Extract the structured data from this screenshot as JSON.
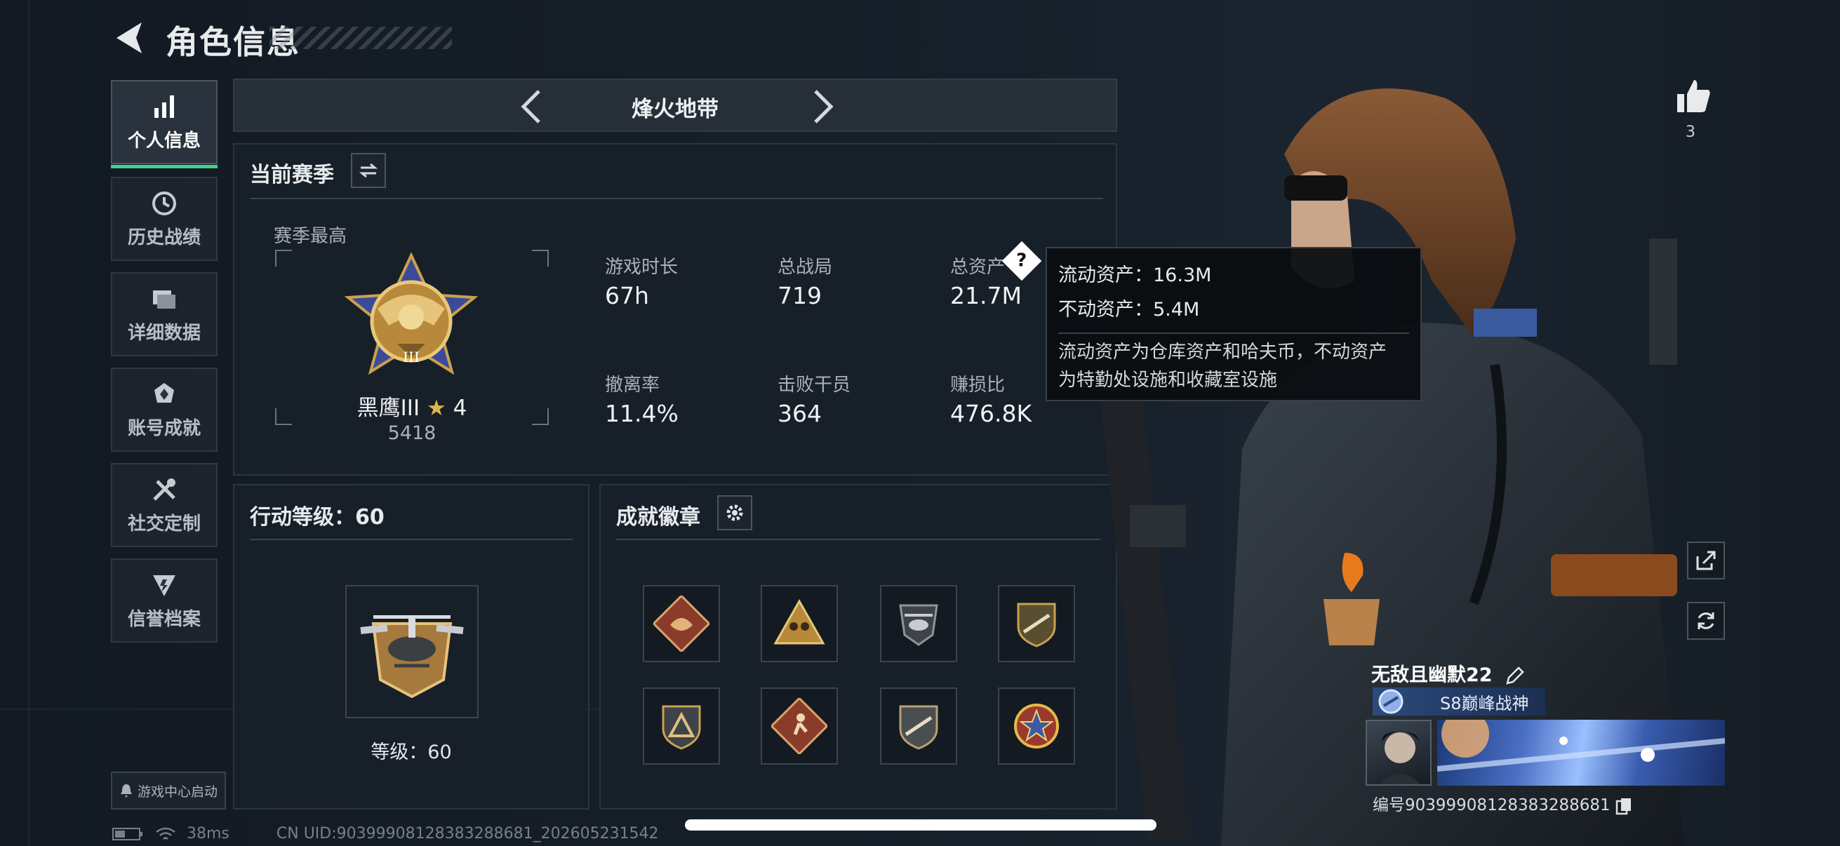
{
  "header": {
    "title": "角色信息"
  },
  "sidebar": {
    "items": [
      {
        "label": "个人信息",
        "icon": "bar-chart-icon",
        "active": true
      },
      {
        "label": "历史战绩",
        "icon": "history-icon"
      },
      {
        "label": "详细数据",
        "icon": "folder-icon"
      },
      {
        "label": "账号成就",
        "icon": "achievement-icon"
      },
      {
        "label": "社交定制",
        "icon": "tools-icon"
      },
      {
        "label": "信誉档案",
        "icon": "reputation-icon"
      }
    ],
    "game_center": "游戏中心启动"
  },
  "mode": {
    "title": "烽火地带"
  },
  "season": {
    "title": "当前赛季",
    "best_label": "赛季最高",
    "rank_name": "黑鹰III",
    "rank_stars": "4",
    "rank_score": "5418",
    "stats": [
      {
        "label": "游戏时长",
        "value": "67h"
      },
      {
        "label": "总战局",
        "value": "719"
      },
      {
        "label": "总资产",
        "value": "21.7M"
      },
      {
        "label": "撤离率",
        "value": "11.4%"
      },
      {
        "label": "击败干员",
        "value": "364"
      },
      {
        "label": "赚损比",
        "value": "476.8K"
      }
    ]
  },
  "tooltip": {
    "liquid": "流动资产：16.3M",
    "fixed": "不动资产：5.4M",
    "desc1": "流动资产为仓库资产和哈夫币，不动资产",
    "desc2": "为特勤处设施和收藏室设施"
  },
  "level": {
    "title": "行动等级：60",
    "label": "等级：60"
  },
  "badges": {
    "title": "成就徽章"
  },
  "player": {
    "likes": "3",
    "name": "无敌且幽默22",
    "rank_title": "S8巅峰战神",
    "id": "编号9039990812838328868​1"
  },
  "footer": {
    "ping": "38ms",
    "uid": "CN UID:9039990812838328868​1_202605231542"
  },
  "colors": {
    "accent": "#3fd28d",
    "bg": "#131a22"
  }
}
